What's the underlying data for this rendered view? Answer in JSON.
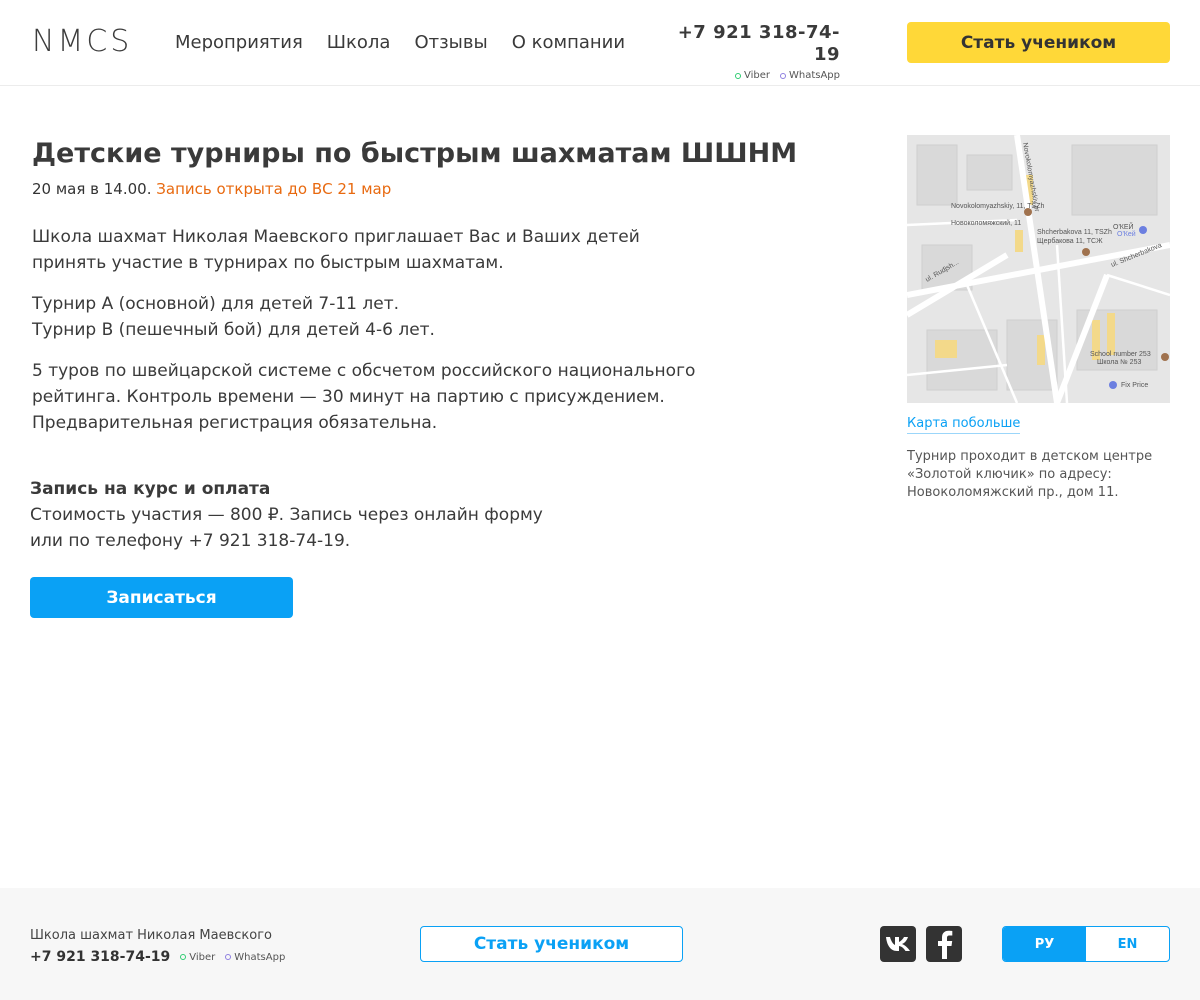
{
  "header": {
    "logo": "NMCS",
    "nav": [
      "Мероприятия",
      "Школа",
      "Отзывы",
      "О компании"
    ],
    "phone": "+7 921 318-74-19",
    "viber": "Viber",
    "whatsapp": "WhatsApp",
    "cta": "Стать учеником"
  },
  "event": {
    "title": "Детские турниры по быстрым шахматам ШШНМ",
    "date": "20 мая в 14.00.",
    "registration": "Запись открыта до ВС 21 мар",
    "p1": "Школа шахмат Николая Маевского приглашает Вас и Ваших детей принять участие в турнирах по быстрым шахматам.",
    "p2_line1": "Турнир А (основной) для детей 7-11 лет.",
    "p2_line2": "Турнир B (пешечный бой) для детей 4-6 лет.",
    "p3": "5 туров по швейцарской системе с обсчетом российского национального рейтинга. Контроль времени — 30 минут на партию с присуждением. Предварительная регистрация обязательна.",
    "section_title": "Запись на курс и оплата",
    "price_line1": "Стоимость участия — 800 ₽. Запись через онлайн форму",
    "price_line2": "или по телефону +7 921 318-74-19.",
    "signup_button": "Записаться"
  },
  "map": {
    "labels": {
      "street1": "Novokolomyazhskiy pr",
      "addr1": "Novokolomyazhskiy, 11, TSZh",
      "addr1_ru": "Новоколомяжский, 11",
      "addr2": "Shcherbakova 11, TSZh",
      "addr2_ru": "Щербакова 11, ТСЖ",
      "okey": "О'КЕЙ",
      "okey2": "О'Кей",
      "street2": "ul. Shcherbakova",
      "street3": "ul. Rudjsh...",
      "school": "School number 253",
      "school_ru": "Школа № 253",
      "fixprice": "Fix Price"
    },
    "link": "Карта побольше",
    "note": "Турнир проходит в детском центре «Золотой ключик» по адресу: Новоколомяжский пр., дом 11."
  },
  "footer": {
    "school": "Школа шахмат Николая Маевского",
    "phone": "+7 921 318-74-19",
    "viber": "Viber",
    "whatsapp": "WhatsApp",
    "cta": "Стать учеником",
    "lang_ru": "РУ",
    "lang_en": "EN"
  }
}
